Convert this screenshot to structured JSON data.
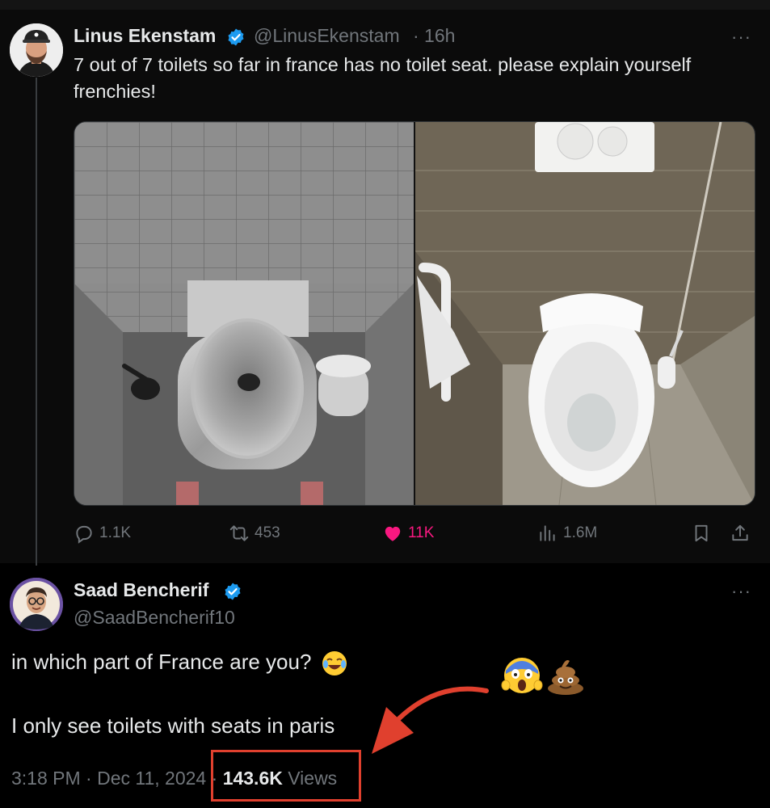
{
  "tweet": {
    "author_name": "Linus Ekenstam",
    "author_handle": "@LinusEkenstam",
    "time_ago": "· 16h",
    "text": "7 out of 7 toilets so far in france has no toilet seat. please explain yourself frenchies!",
    "more_label": "···",
    "stats": {
      "replies": "1.1K",
      "reposts": "453",
      "likes": "11K",
      "views": "1.6M"
    }
  },
  "reply": {
    "author_name": "Saad Bencherif",
    "author_handle": "@SaadBencherif10",
    "more_label": "···",
    "line1": "in which part of France are you?",
    "line2": "I only see toilets with seats in paris",
    "time": "3:18 PM",
    "date": "Dec 11, 2024",
    "separator": "·",
    "views_count": "143.6K",
    "views_label": "Views"
  },
  "colors": {
    "accent_blue": "#1d9bf0",
    "like_pink": "#f91880",
    "annotation_red": "#e0402e"
  },
  "icons": [
    "verified-badge-icon",
    "reply-icon",
    "repost-icon",
    "heart-icon",
    "views-icon",
    "bookmark-icon",
    "share-icon",
    "more-icon",
    "laughing-emoji",
    "screaming-emoji",
    "poop-emoji"
  ]
}
